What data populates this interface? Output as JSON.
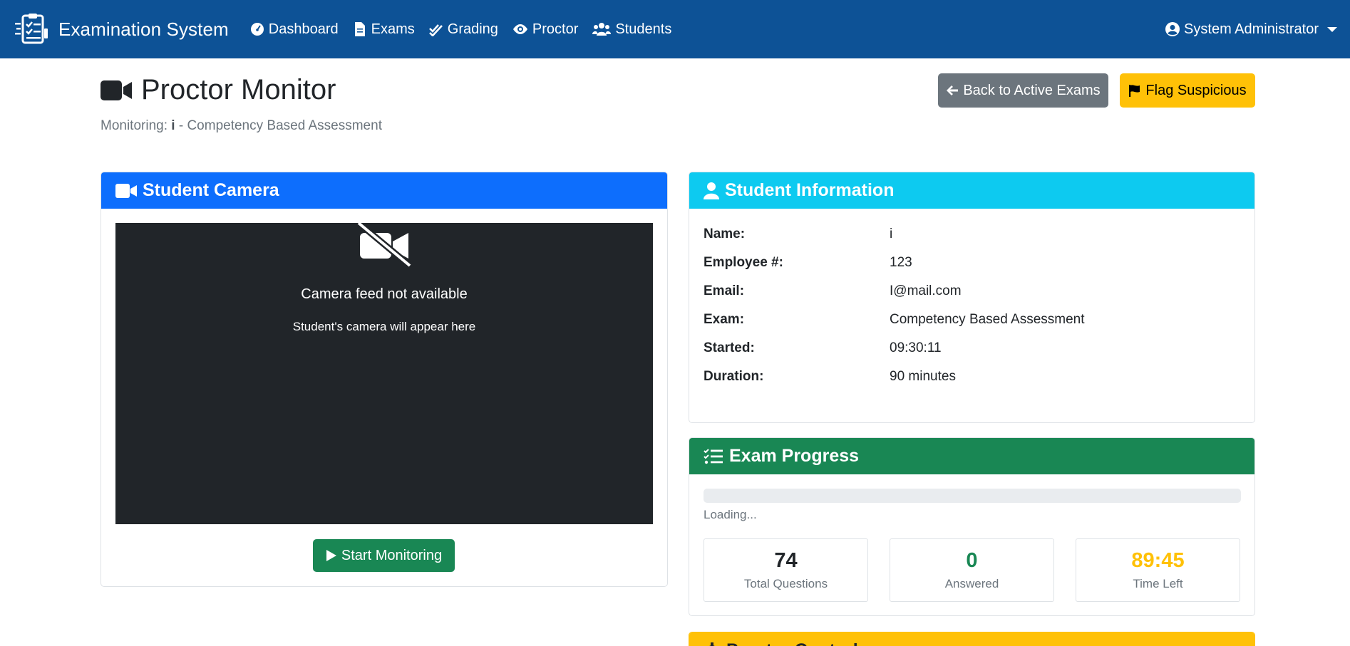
{
  "navbar": {
    "brand": "Examination System",
    "links": [
      {
        "label": "Dashboard",
        "icon": "gauge-icon"
      },
      {
        "label": "Exams",
        "icon": "file-icon"
      },
      {
        "label": "Grading",
        "icon": "check-double-icon"
      },
      {
        "label": "Proctor",
        "icon": "eye-icon"
      },
      {
        "label": "Students",
        "icon": "users-icon"
      }
    ],
    "user": "System Administrator"
  },
  "header": {
    "title": "Proctor Monitor",
    "monitoring_prefix": "Monitoring:",
    "student_short": "i",
    "monitoring_suffix": "- Competency Based Assessment",
    "back_button": "Back to Active Exams",
    "flag_button": "Flag Suspicious"
  },
  "camera": {
    "title": "Student Camera",
    "feed_title": "Camera feed not available",
    "feed_subtitle": "Student's camera will appear here",
    "start_button": "Start Monitoring"
  },
  "student_info": {
    "title": "Student Information",
    "rows": [
      {
        "label": "Name:",
        "value": "i"
      },
      {
        "label": "Employee #:",
        "value": "123"
      },
      {
        "label": "Email:",
        "value": "I@mail.com"
      },
      {
        "label": "Exam:",
        "value": "Competency Based Assessment"
      },
      {
        "label": "Started:",
        "value": "09:30:11"
      },
      {
        "label": "Duration:",
        "value": "90 minutes"
      }
    ]
  },
  "progress": {
    "title": "Exam Progress",
    "status": "Loading...",
    "fill_percent": 0,
    "stats": [
      {
        "value": "74",
        "label": "Total Questions",
        "color": "#212529"
      },
      {
        "value": "0",
        "label": "Answered",
        "color": "#198754"
      },
      {
        "value": "89:45",
        "label": "Time Left",
        "color": "#ffc107"
      }
    ]
  },
  "controls": {
    "title": "Proctor Controls"
  },
  "colors": {
    "navbar": "#0d5296",
    "primary": "#0d6efd",
    "info": "#0dcaf0",
    "success": "#198754",
    "warning": "#ffc107",
    "secondary": "#6c757d"
  }
}
